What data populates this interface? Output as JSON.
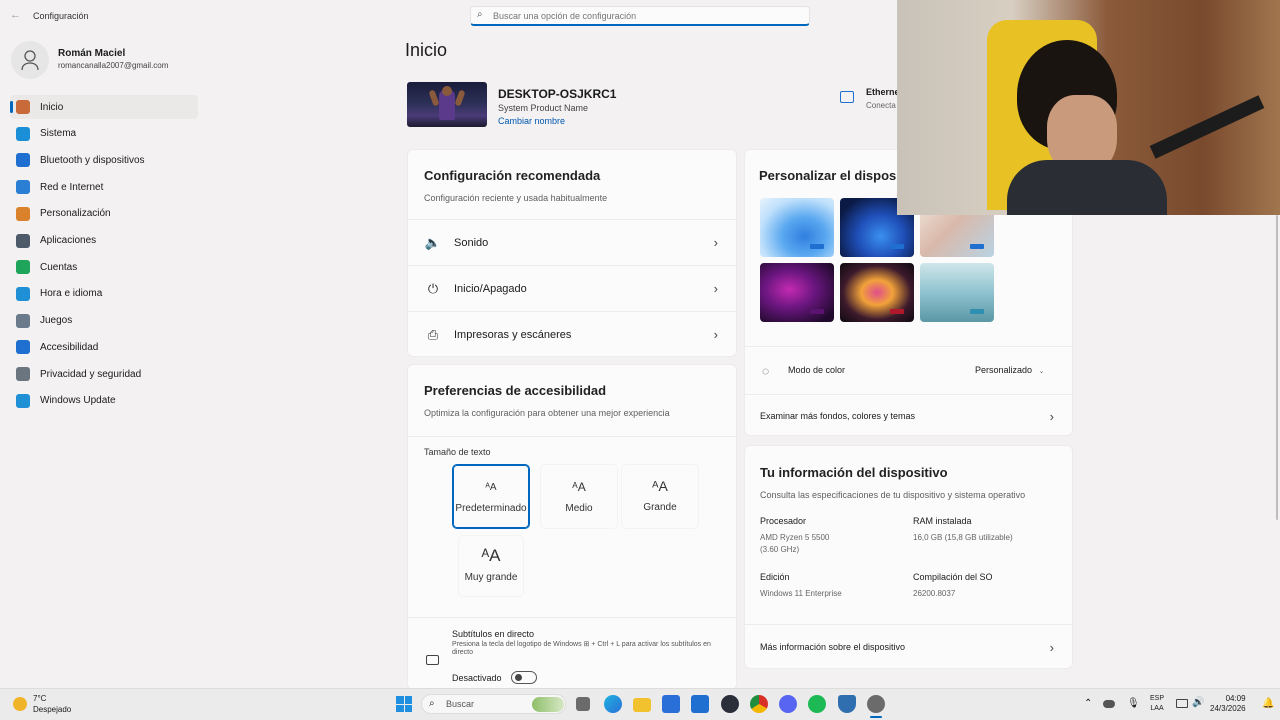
{
  "window": {
    "title": "Configuración"
  },
  "search": {
    "placeholder": "Buscar una opción de configuración"
  },
  "user": {
    "name": "Román Maciel",
    "email": "romancanalla2007@gmail.com"
  },
  "sidebar": {
    "items": [
      {
        "label": "Inicio",
        "icon": "home-icon",
        "color": "#c96a3a"
      },
      {
        "label": "Sistema",
        "icon": "system-icon",
        "color": "#1a8fd8"
      },
      {
        "label": "Bluetooth y dispositivos",
        "icon": "bluetooth-icon",
        "color": "#1f6fd1"
      },
      {
        "label": "Red e Internet",
        "icon": "network-icon",
        "color": "#2a7fd4"
      },
      {
        "label": "Personalización",
        "icon": "brush-icon",
        "color": "#d9822b"
      },
      {
        "label": "Aplicaciones",
        "icon": "apps-icon",
        "color": "#4d5a6a"
      },
      {
        "label": "Cuentas",
        "icon": "accounts-icon",
        "color": "#1fa55b"
      },
      {
        "label": "Hora e idioma",
        "icon": "globe-icon",
        "color": "#1f8fd6"
      },
      {
        "label": "Juegos",
        "icon": "gamepad-icon",
        "color": "#6b7b8c"
      },
      {
        "label": "Accesibilidad",
        "icon": "accessibility-icon",
        "color": "#1f6fd1"
      },
      {
        "label": "Privacidad y seguridad",
        "icon": "shield-icon",
        "color": "#6b7580"
      },
      {
        "label": "Windows Update",
        "icon": "update-icon",
        "color": "#1f8fd6"
      }
    ]
  },
  "page": {
    "title": "Inicio"
  },
  "device": {
    "name": "DESKTOP-OSJKRC1",
    "subtitle": "System Product Name",
    "rename": "Cambiar nombre",
    "network_label": "Etherne",
    "network_status": "Conecta"
  },
  "recommended": {
    "title": "Configuración recomendada",
    "subtitle": "Configuración reciente y usada habitualmente",
    "rows": [
      {
        "label": "Sonido",
        "icon": "speaker-icon"
      },
      {
        "label": "Inicio/Apagado",
        "icon": "power-icon"
      },
      {
        "label": "Impresoras y escáneres",
        "icon": "printer-icon"
      }
    ]
  },
  "accessibility": {
    "title": "Preferencias de accesibilidad",
    "subtitle": "Optimiza la configuración para obtener una mejor experiencia",
    "text_size_label": "Tamaño de texto",
    "sizes": [
      "Predeterminado",
      "Medio",
      "Grande",
      "Muy grande"
    ],
    "captions_title": "Subtítulos en directo",
    "captions_desc": "Presiona la tecla del logotipo de Windows ⊞ + Ctrl + L para activar los subtítulos en directo",
    "toggle_label": "Desactivado"
  },
  "personalize": {
    "title": "Personalizar el dispositi",
    "color_mode_label": "Modo de color",
    "color_mode_value": "Personalizado",
    "more_link": "Examinar más fondos, colores y temas"
  },
  "device_info": {
    "title": "Tu información del dispositivo",
    "subtitle": "Consulta las especificaciones de tu dispositivo y sistema operativo",
    "processor_label": "Procesador",
    "processor_value_1": "AMD Ryzen 5 5500",
    "processor_value_2": "(3.60 GHz)",
    "ram_label": "RAM instalada",
    "ram_value": "16,0 GB (15,8 GB utilizable)",
    "edition_label": "Edición",
    "edition_value": "Windows 11 Enterprise",
    "build_label": "Compilación del SO",
    "build_value": "26200.8037",
    "more_link": "Más información sobre el dispositivo"
  },
  "taskbar": {
    "weather_temp": "7°C",
    "weather_desc": "Despejado",
    "search_label": "Buscar",
    "lang_1": "ESP",
    "lang_2": "LAA",
    "time": "04:09",
    "date": "24/3/2026"
  },
  "colors": {
    "accent": "#0067c0",
    "link": "#0058b0"
  }
}
